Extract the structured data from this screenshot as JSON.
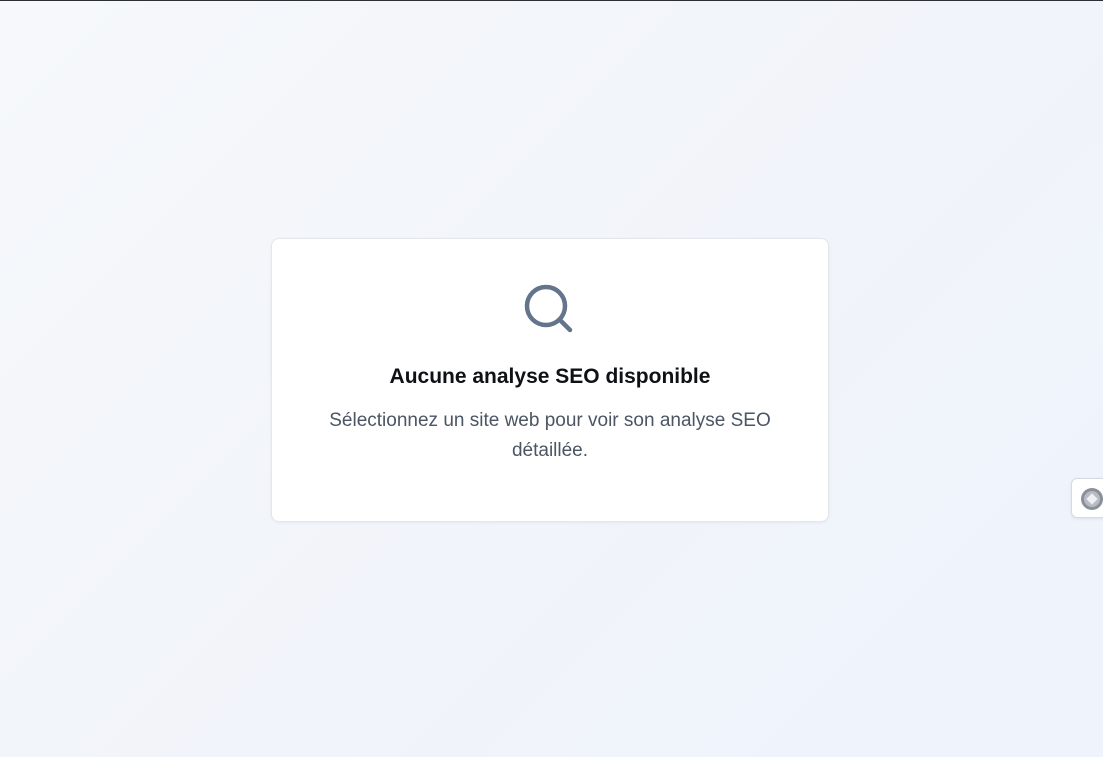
{
  "empty_state": {
    "icon": "search-icon",
    "title": "Aucune analyse SEO disponible",
    "description": "Sélectionnez un site web pour voir son analyse SEO détaillée."
  },
  "side_widget": {
    "icon": "extension-widget-icon"
  },
  "colors": {
    "icon": "#64748b",
    "title": "#0f1115",
    "description": "#4b5563",
    "card_border": "#e3e6ea"
  }
}
